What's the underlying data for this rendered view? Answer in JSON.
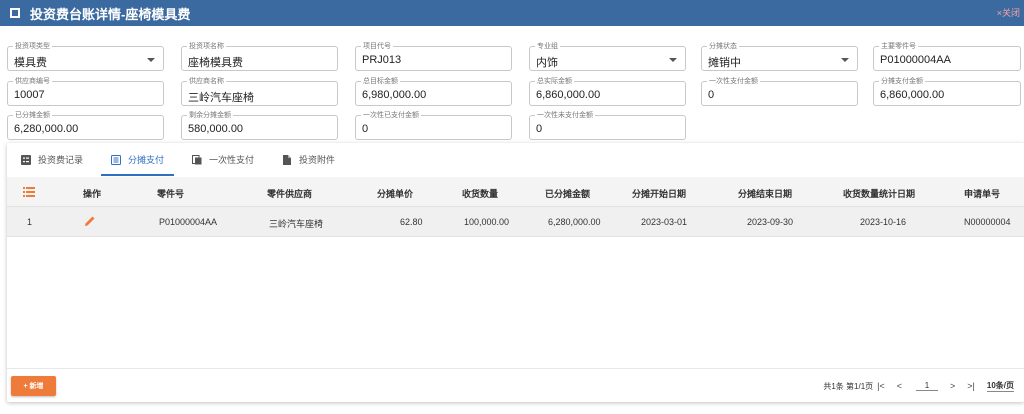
{
  "window": {
    "title": "投资费台账详情-座椅模具费",
    "close_label": "×关闭"
  },
  "form": [
    {
      "label": "投资项类型",
      "value": "模具费",
      "dropdown": true
    },
    {
      "label": "投资项名称",
      "value": "座椅模具费",
      "dropdown": false
    },
    {
      "label": "项目代号",
      "value": "PRJ013",
      "dropdown": false
    },
    {
      "label": "专业组",
      "value": "内饰",
      "dropdown": true
    },
    {
      "label": "分摊状态",
      "value": "摊销中",
      "dropdown": true
    },
    {
      "label": "主要零件号",
      "value": "P01000004AA",
      "dropdown": false
    },
    {
      "label": "供应商编号",
      "value": "10007",
      "dropdown": false
    },
    {
      "label": "供应商名称",
      "value": "三岭汽车座椅",
      "dropdown": false
    },
    {
      "label": "总目标金额",
      "value": "6,980,000.00",
      "dropdown": false
    },
    {
      "label": "总实际金额",
      "value": "6,860,000.00",
      "dropdown": false
    },
    {
      "label": "一次性支付金额",
      "value": "0",
      "dropdown": false
    },
    {
      "label": "分摊支付金额",
      "value": "6,860,000.00",
      "dropdown": false
    },
    {
      "label": "已分摊金额",
      "value": "6,280,000.00",
      "dropdown": false
    },
    {
      "label": "剩余分摊金额",
      "value": "580,000.00",
      "dropdown": false
    },
    {
      "label": "一次性已支付金额",
      "value": "0",
      "dropdown": false
    },
    {
      "label": "一次性未支付金额",
      "value": "0",
      "dropdown": false
    }
  ],
  "tabs": [
    {
      "label": "投资费记录",
      "icon": "list-icon",
      "active": false
    },
    {
      "label": "分摊支付",
      "icon": "document-list-icon",
      "active": true
    },
    {
      "label": "一次性支付",
      "icon": "copy-icon",
      "active": false
    },
    {
      "label": "投资附件",
      "icon": "file-icon",
      "active": false
    }
  ],
  "table": {
    "columns": [
      "操作",
      "零件号",
      "零件供应商",
      "分摊单价",
      "收货数量",
      "已分摊金额",
      "分摊开始日期",
      "分摊结束日期",
      "收货数量统计日期",
      "申请单号"
    ],
    "rows": [
      {
        "index": "1",
        "cells": [
          "P01000004AA",
          "三岭汽车座椅",
          "62.80",
          "100,000.00",
          "6,280,000.00",
          "2023-03-01",
          "2023-09-30",
          "2023-10-16",
          "N00000004"
        ]
      }
    ]
  },
  "footer": {
    "add_label": "+ 新增",
    "page_info": "共1条 第1/1页",
    "first": "|<",
    "prev": "<",
    "page": "1",
    "next": ">",
    "last": ">|",
    "page_size": "10条/页"
  },
  "colors": {
    "titlebar": "#3b6aa0",
    "accent": "#2f6fc4",
    "add_button": "#ee7b3a",
    "edit_icon": "#ee7b3a"
  }
}
